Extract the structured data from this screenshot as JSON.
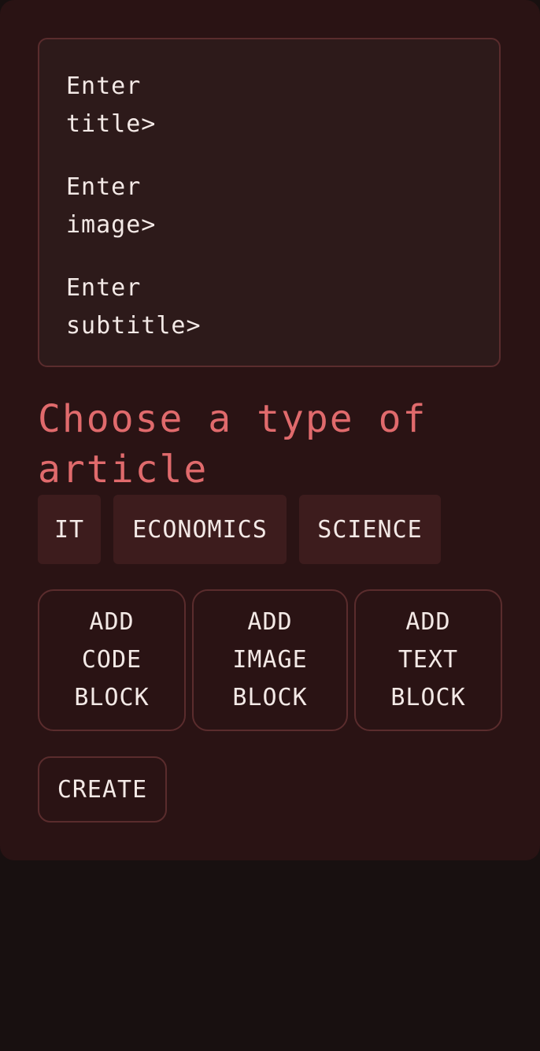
{
  "form": {
    "title_prompt": [
      "Enter",
      "title>"
    ],
    "image_prompt": [
      "Enter",
      "image>"
    ],
    "subtitle_prompt": [
      "Enter",
      "subtitle>"
    ]
  },
  "article_type": {
    "heading": "Choose a type of article",
    "options": [
      "IT",
      "ECONOMICS",
      "SCIENCE"
    ]
  },
  "blocks": {
    "code": [
      "ADD",
      "CODE",
      "BLOCK"
    ],
    "image": [
      "ADD",
      "IMAGE",
      "BLOCK"
    ],
    "text": [
      "ADD",
      "TEXT",
      "BLOCK"
    ]
  },
  "actions": {
    "create_label": "CREATE"
  },
  "colors": {
    "page_background": "#181010",
    "card_background": "#2a1314",
    "input_background": "#2d1a1a",
    "border": "#5a2c2d",
    "accent": "#e06a6c",
    "chip_background": "#3d1c1d",
    "text": "#f3e9e6"
  }
}
